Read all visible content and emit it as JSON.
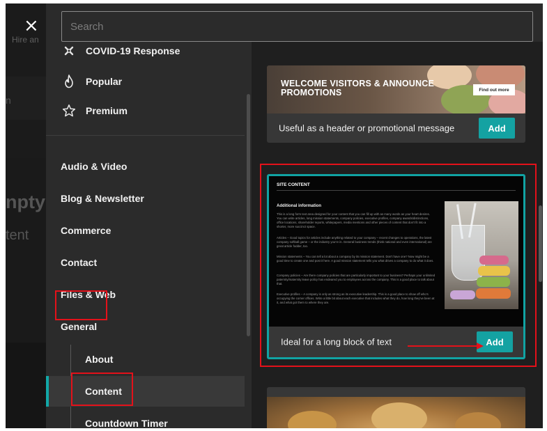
{
  "background_page": {
    "close_label": "×",
    "hire_text": "Hire an",
    "fragment_n": "n",
    "fragment_pty": "npty",
    "fragment_tent": "tent"
  },
  "search": {
    "placeholder": "Search"
  },
  "sidebar": {
    "top_items": [
      {
        "label": "COVID-19 Response",
        "icon": "covid-icon"
      },
      {
        "label": "Popular",
        "icon": "flame-icon"
      },
      {
        "label": "Premium",
        "icon": "star-icon"
      }
    ],
    "categories": [
      {
        "label": "Audio & Video"
      },
      {
        "label": "Blog & Newsletter"
      },
      {
        "label": "Commerce"
      },
      {
        "label": "Contact"
      },
      {
        "label": "Files & Web"
      },
      {
        "label": "General"
      }
    ],
    "subcategories": [
      {
        "label": "About"
      },
      {
        "label": "Content",
        "active": true
      },
      {
        "label": "Countdown Timer"
      }
    ]
  },
  "cards": [
    {
      "preview_title": "WELCOME VISITORS & ANNOUNCE PROMOTIONS",
      "preview_button": "Find out more",
      "description": "Useful as a header or promotional message",
      "add_label": "Add"
    },
    {
      "preview_section": "SITE CONTENT",
      "preview_heading": "Additional information",
      "preview_paragraphs": [
        "This is a long form text area designed for your content that you can fill up with as many words as your heart desires. You can write articles, long mission statements, company policies, executive profiles, company awards/distinctions, office locations, shareholder reports, whitepapers, media mentions and other pieces of content that don't fit into a shorter, more succinct space.",
        "Articles – Good topics for articles include anything related to your company – recent changes to operations, the latest company softball game – or the industry you're in. General business trends (think national and even international) are great article fodder, too.",
        "Mission statements – You can tell a lot about a company by its mission statement. Don't have one? Now might be a good time to create one and post it here. A good mission statement tells you what drives a company to do what it does.",
        "Company policies – Are there company policies that are particularly important to your business? Perhaps your unlimited paternity/maternity leave policy has endeared you to employees across the company. This is a good place to talk about that.",
        "Executive profiles – A company is only as strong as its executive leadership. This is a good place to show off who's occupying the corner offices. Write a little bit about each executive that includes what they do, how long they've been at it, and what got them to where they are."
      ],
      "description": "Ideal for a long block of text",
      "add_label": "Add"
    }
  ],
  "colors": {
    "accent": "#14a2a2",
    "highlight": "#e4111a",
    "modal_bg": "#2b2b2b",
    "content_bg": "#1f1f1f"
  }
}
